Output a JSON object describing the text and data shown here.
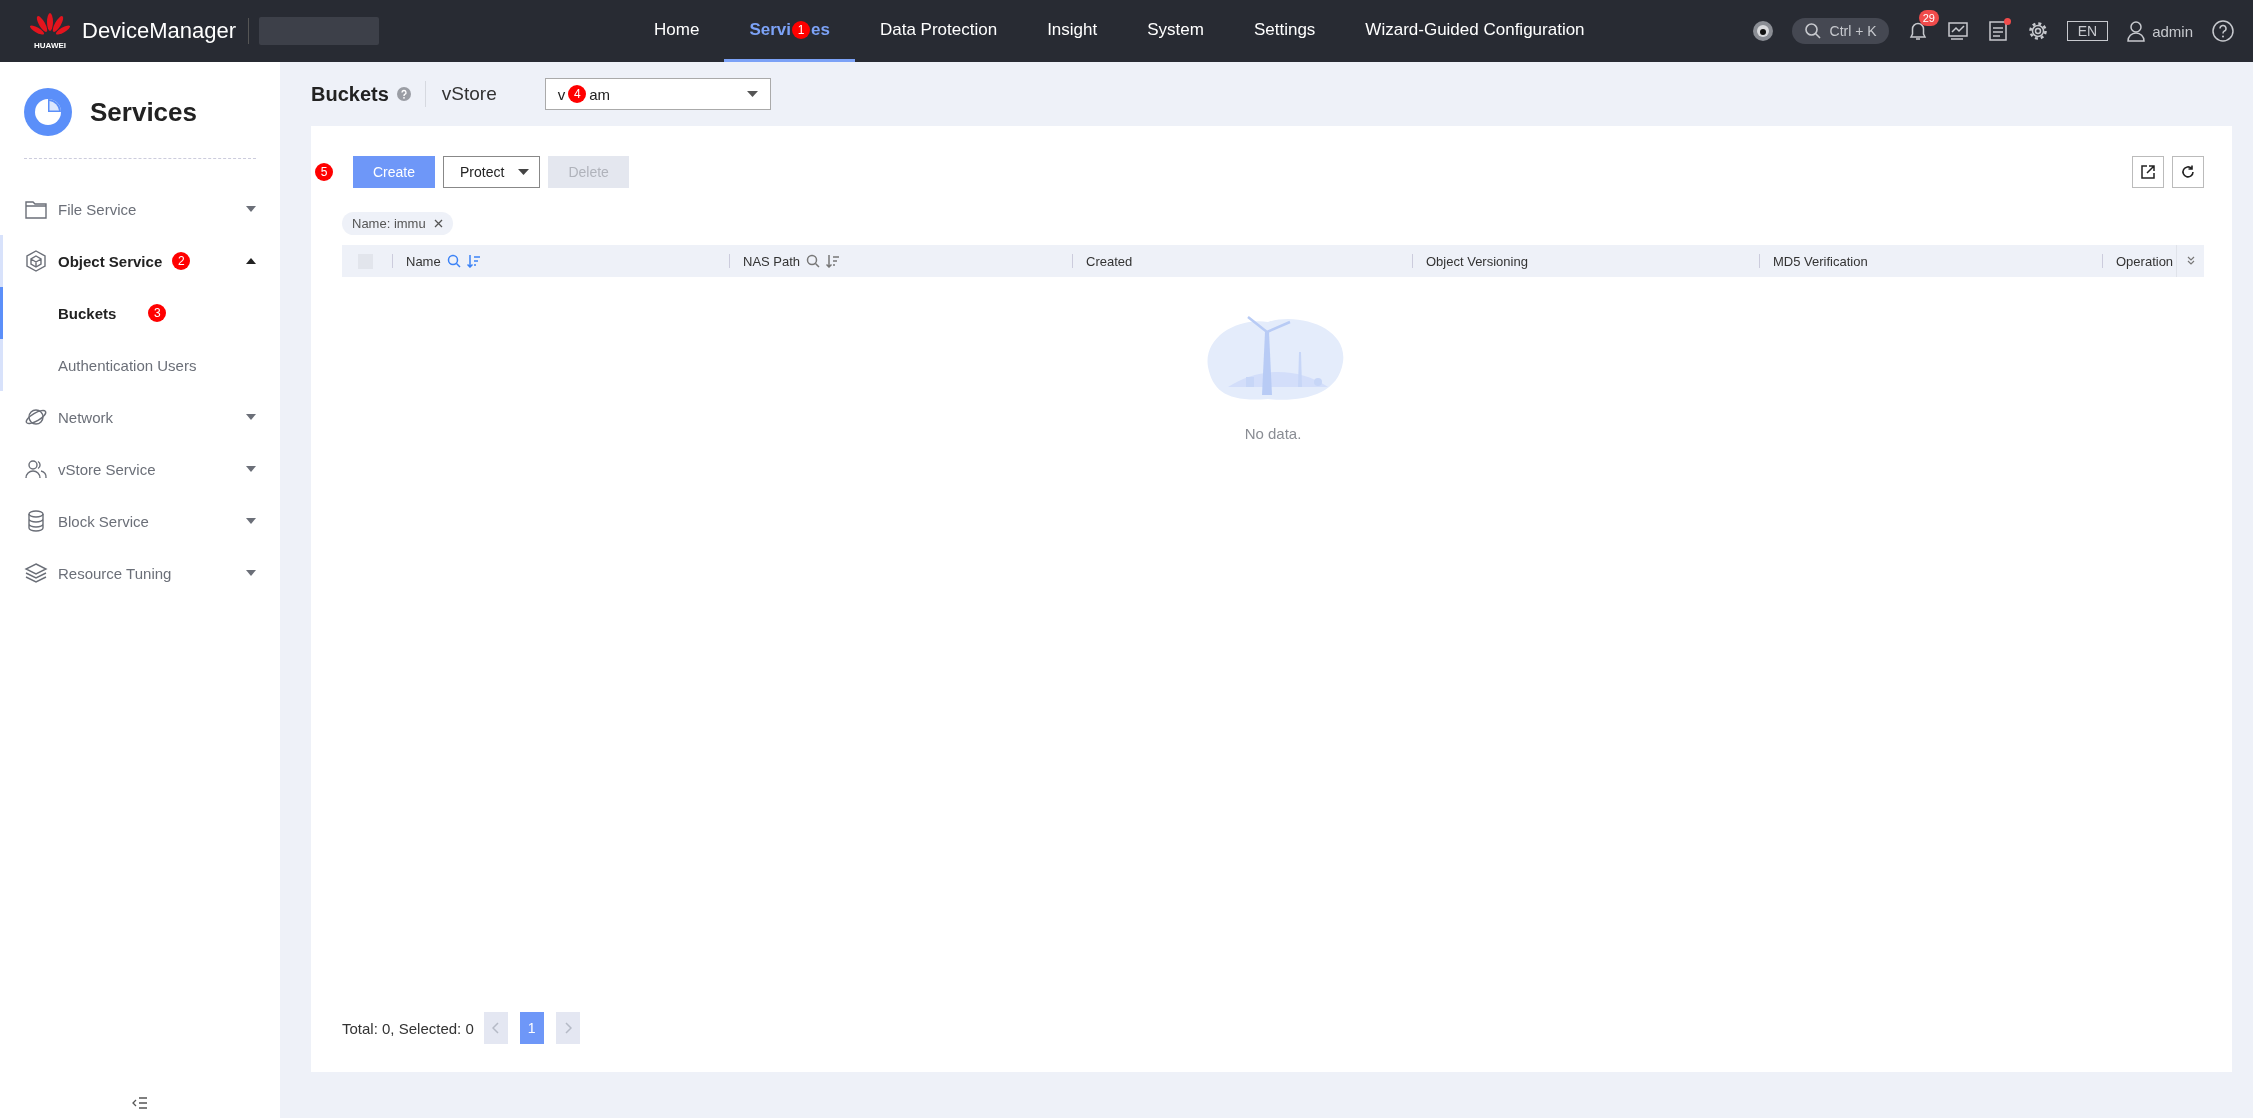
{
  "header": {
    "brand": "HUAWEI",
    "app_name": "DeviceManager"
  },
  "nav": [
    {
      "label": "Home",
      "selected": false
    },
    {
      "label_parts": [
        "Servi",
        "es"
      ],
      "callout": "1",
      "selected": true
    },
    {
      "label": "Data Protection",
      "selected": false
    },
    {
      "label": "Insight",
      "selected": false
    },
    {
      "label": "System",
      "selected": false
    },
    {
      "label": "Settings",
      "selected": false
    },
    {
      "label": "Wizard-Guided Configuration",
      "selected": false
    }
  ],
  "search": {
    "placeholder": "Ctrl + K"
  },
  "notifications": {
    "count": "29"
  },
  "tasks": {
    "unread": true
  },
  "language": "EN",
  "user": "admin",
  "sidebar": {
    "title": "Services",
    "items": [
      {
        "label": "File Service",
        "expanded": false
      },
      {
        "label": "Object Service",
        "expanded": true,
        "callout": "2",
        "children": [
          {
            "label": "Buckets",
            "selected": true,
            "callout": "3"
          },
          {
            "label": "Authentication Users",
            "selected": false
          }
        ]
      },
      {
        "label": "Network",
        "expanded": false
      },
      {
        "label": "vStore Service",
        "expanded": false
      },
      {
        "label": "Block Service",
        "expanded": false
      },
      {
        "label": "Resource Tuning",
        "expanded": false
      }
    ]
  },
  "page": {
    "title": "Buckets",
    "vstore_label": "vStore",
    "vstore_value_parts": [
      "v",
      "am"
    ],
    "vstore_callout": "4"
  },
  "toolbar": [
    {
      "label": "Create",
      "kind": "primary",
      "disabled": false,
      "callout": "5"
    },
    {
      "label": "Protect",
      "kind": "dropdown"
    },
    {
      "label": "Delete",
      "kind": "primary",
      "disabled": true
    }
  ],
  "filters": [
    {
      "label": "Name: immu"
    }
  ],
  "table": {
    "select_all": {
      "checked": false
    },
    "columns": [
      {
        "label": "Name",
        "filtered": true
      },
      {
        "label": "NAS Path",
        "filtered": false
      },
      {
        "label": "Created"
      },
      {
        "label": "Object Versioning"
      },
      {
        "label": "MD5 Verification"
      },
      {
        "label": "Operation"
      }
    ],
    "empty_text": "No data."
  },
  "pagination": {
    "summary": "Total: 0, Selected: 0",
    "pages": [
      {
        "label": "1",
        "selected": true
      }
    ]
  }
}
